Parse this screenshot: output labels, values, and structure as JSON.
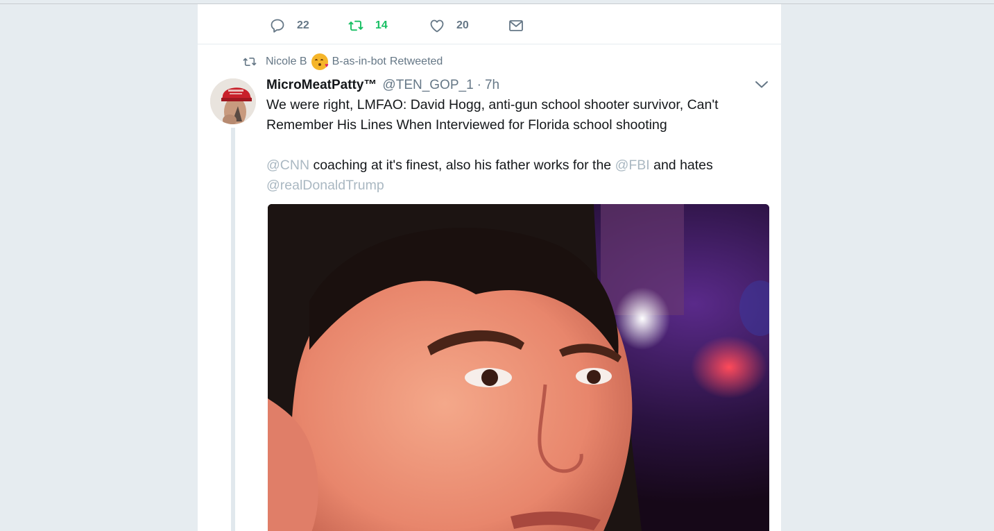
{
  "previous_tweet": {
    "actions": {
      "reply_count": "22",
      "retweet_count": "14",
      "like_count": "20"
    }
  },
  "retweet_context": {
    "retweeter": "Nicole B",
    "retweeter_suffix": "B-as-in-bot",
    "action_text": "Retweeted"
  },
  "tweet": {
    "display_name": "MicroMeatPatty™",
    "handle": "@TEN_GOP_1",
    "separator": "·",
    "timestamp": "7h",
    "text_line_1": "We were right, LMFAO: David Hogg, anti-gun school shooter survivor, Can't Remember His Lines When Interviewed for Florida school shooting",
    "mention_cnn": "@CNN",
    "text_mid_1": " coaching at it's finest, also his father works for the ",
    "mention_fbi": "@FBI",
    "text_mid_2": " and hates ",
    "mention_trump": "@realDonaldTrump",
    "media_description_icon": "video-thumbnail"
  },
  "icons": {
    "reply": "speech-bubble-icon",
    "retweet": "retweet-arrows-icon",
    "like": "heart-icon",
    "dm": "envelope-icon",
    "menu": "chevron-down-icon"
  },
  "colors": {
    "background": "#e6ecf0",
    "retweet_active": "#17bf63",
    "secondary_text": "#657786",
    "mention": "#aab8c2"
  }
}
